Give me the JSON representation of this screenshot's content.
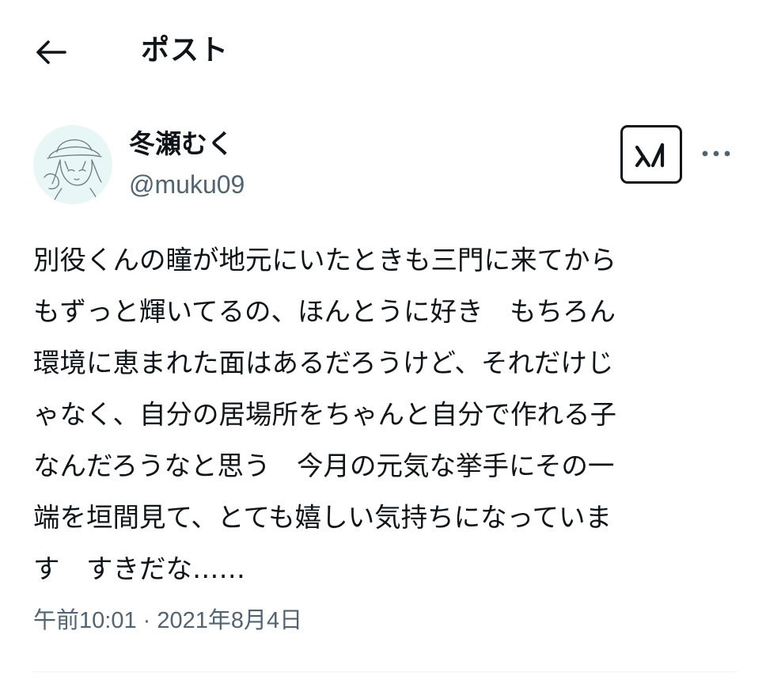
{
  "header": {
    "title": "ポスト",
    "back_icon": "arrow-left-icon"
  },
  "post": {
    "author": {
      "display_name": "冬瀬むく",
      "handle": "@muku09",
      "avatar_icon": "user-avatar"
    },
    "grok_icon": "grok-icon",
    "more_icon": "more-horizontal-icon",
    "text": "別役くんの瞳が地元にいたときも三門に来てから\nもずっと輝いてるの、ほんとうに好き　もちろん\n環境に恵まれた面はあるだろうけど、それだけじ\nゃなく、自分の居場所をちゃんと自分で作れる子\nなんだろうなと思う　今月の元気な挙手にその一\n端を垣間見て、とても嬉しい気持ちになっていま\nす　すきだな……",
    "time": "午前10:01",
    "separator": "·",
    "date": "2021年8月4日"
  },
  "colors": {
    "text": "#0f1419",
    "secondary_text": "#536471",
    "avatar_bg": "#e9f6f6",
    "divider": "#eff3f4"
  }
}
